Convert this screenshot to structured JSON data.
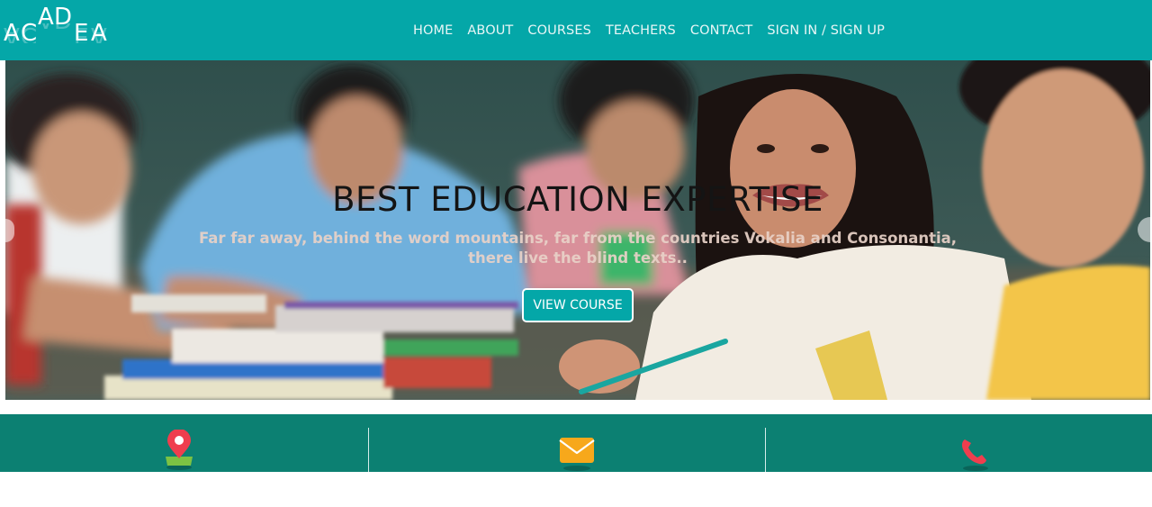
{
  "brand": {
    "logo_text": "ACADEA",
    "letters": [
      "A",
      "C",
      "A",
      "D",
      "E",
      "A"
    ]
  },
  "nav": {
    "items": [
      {
        "label": "HOME"
      },
      {
        "label": "ABOUT"
      },
      {
        "label": "COURSES"
      },
      {
        "label": "TEACHERS"
      },
      {
        "label": "CONTACT"
      },
      {
        "label": "SIGN IN / SIGN UP"
      }
    ]
  },
  "hero": {
    "title": "BEST EDUCATION EXPERTISE",
    "subtitle": "Far far away, behind the word mountains, far from the countries Vokalia and Consonantia, there live the blind texts..",
    "button_label": "VIEW COURSE"
  },
  "info": {
    "items": [
      {
        "icon": "location-pin-icon"
      },
      {
        "icon": "envelope-icon"
      },
      {
        "icon": "phone-icon"
      }
    ]
  },
  "colors": {
    "nav_bg": "#04a7a8",
    "info_bg": "#0c8072",
    "button_bg": "#04a7a8"
  }
}
